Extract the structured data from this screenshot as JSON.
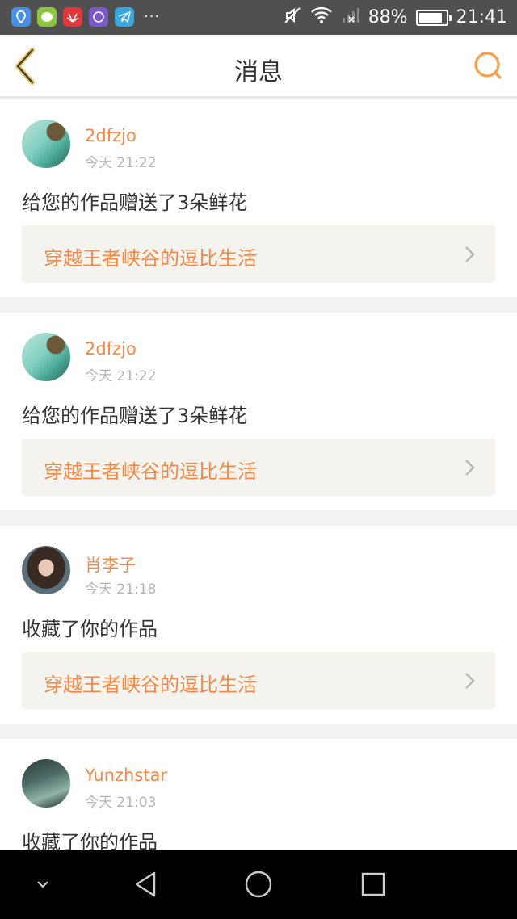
{
  "status_bar": {
    "app_icons": [
      "location-app-icon",
      "messenger-app-icon",
      "huawei-app-icon",
      "browser-app-icon",
      "telegram-app-icon"
    ],
    "more": "···",
    "battery": "88%",
    "battery_level": 0.88,
    "time": "21:41"
  },
  "header": {
    "title": "消息",
    "accent_color": "#f08a4b"
  },
  "messages": [
    {
      "username": "2dfzjo",
      "time": "今天 21:22",
      "action": "给您的作品赠送了3朵鲜花",
      "work_title": "穿越王者峡谷的逗比生活"
    },
    {
      "username": "2dfzjo",
      "time": "今天 21:22",
      "action": "给您的作品赠送了3朵鲜花",
      "work_title": "穿越王者峡谷的逗比生活"
    },
    {
      "username": "肖李子",
      "time": "今天 21:18",
      "action": "收藏了你的作品",
      "work_title": "穿越王者峡谷的逗比生活"
    },
    {
      "username": "Yunzhstar",
      "time": "今天 21:03",
      "action": "收藏了你的作品",
      "work_title": ""
    }
  ]
}
